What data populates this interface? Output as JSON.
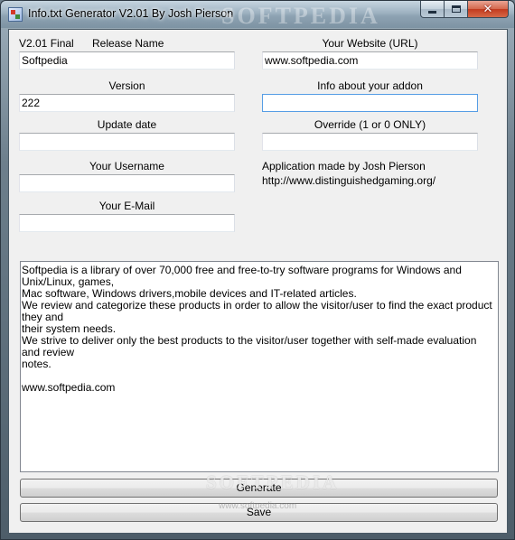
{
  "window": {
    "title": "Info.txt Generator V2.01 By Josh Pierson",
    "watermark": "SOFTPEDIA"
  },
  "form": {
    "version_tag": "V2.01 Final",
    "release_name": {
      "label": "Release Name",
      "value": "Softpedia"
    },
    "version": {
      "label": "Version",
      "value": "222"
    },
    "update_date": {
      "label": "Update date",
      "value": ""
    },
    "username": {
      "label": "Your Username",
      "value": ""
    },
    "email": {
      "label": "Your E-Mail",
      "value": ""
    },
    "website": {
      "label": "Your Website (URL)",
      "value": "www.softpedia.com"
    },
    "addon_info": {
      "label": "Info about your addon",
      "value": ""
    },
    "override": {
      "label": "Override (1 or 0 ONLY)",
      "value": ""
    },
    "credit_line1": "Application made by Josh Pierson",
    "credit_line2": "http://www.distinguishedgaming.org/"
  },
  "notes": {
    "text": "Softpedia is a library of over 70,000 free and free-to-try software programs for Windows and Unix/Linux, games,\nMac software, Windows drivers,mobile devices and IT-related articles.\nWe review and categorize these products in order to allow the visitor/user to find the exact product they and\ntheir system needs.\nWe strive to deliver only the best products to the visitor/user together with self-made evaluation and review\nnotes.\n\nwww.softpedia.com"
  },
  "buttons": {
    "generate": "Generate",
    "save": "Save"
  },
  "overlay": {
    "watermark": "SOFTPEDIA",
    "watermark_url": "www.softpedia.com"
  }
}
